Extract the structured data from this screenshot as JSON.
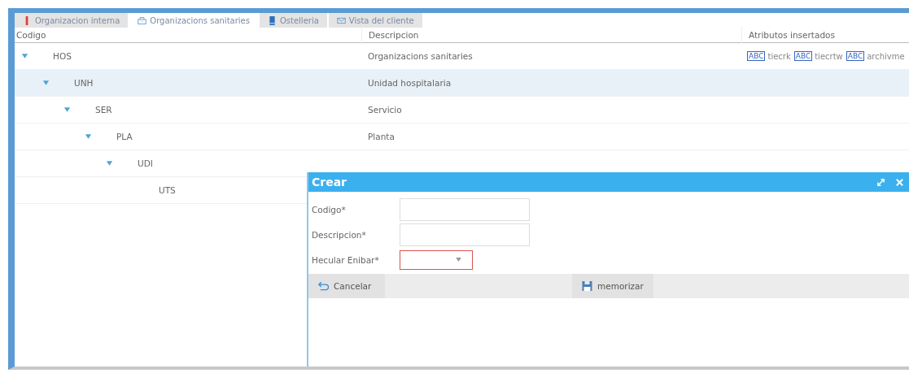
{
  "tabs": [
    {
      "label": "Organizacion interna",
      "selected": false
    },
    {
      "label": "Organizacions sanitaries",
      "selected": true
    },
    {
      "label": "Ostelleria",
      "selected": false
    },
    {
      "label": "Vista del cliente",
      "selected": false
    }
  ],
  "table": {
    "columns": [
      "Codigo",
      "Descripcion",
      "Atributos insertados"
    ],
    "rows": [
      {
        "code": "HOS",
        "description": "Organizacions sanitaries",
        "expanded": true,
        "selected": false,
        "attributes": [
          {
            "badge": "ABC",
            "label": "tiecrk"
          },
          {
            "badge": "ABC",
            "label": "tiecrtw"
          },
          {
            "badge": "ABC",
            "label": "archivme"
          }
        ],
        "children": [
          {
            "code": "UNH",
            "description": "Unidad hospitalaria",
            "expanded": true,
            "selected": true,
            "children": [
              {
                "code": "SER",
                "description": "Servicio",
                "expanded": true,
                "selected": false,
                "children": [
                  {
                    "code": "PLA",
                    "description": "Planta",
                    "expanded": true,
                    "selected": false,
                    "children": [
                      {
                        "code": "UDI",
                        "expanded": true,
                        "selected": false,
                        "children": [
                          {
                            "code": "UTS",
                            "selected": false
                          }
                        ]
                      }
                    ]
                  }
                ]
              }
            ]
          }
        ]
      }
    ]
  },
  "dialog": {
    "title": "Crear",
    "fields": [
      {
        "label": "Codigo*",
        "kind": "text"
      },
      {
        "label": "Descripcion*",
        "kind": "text"
      },
      {
        "label": "Hecular Enibar*",
        "kind": "select",
        "invalid": true
      }
    ],
    "buttons": [
      {
        "label": "Cancelar",
        "kind": "cancel"
      },
      {
        "label": "memorizar",
        "kind": "save"
      }
    ]
  }
}
